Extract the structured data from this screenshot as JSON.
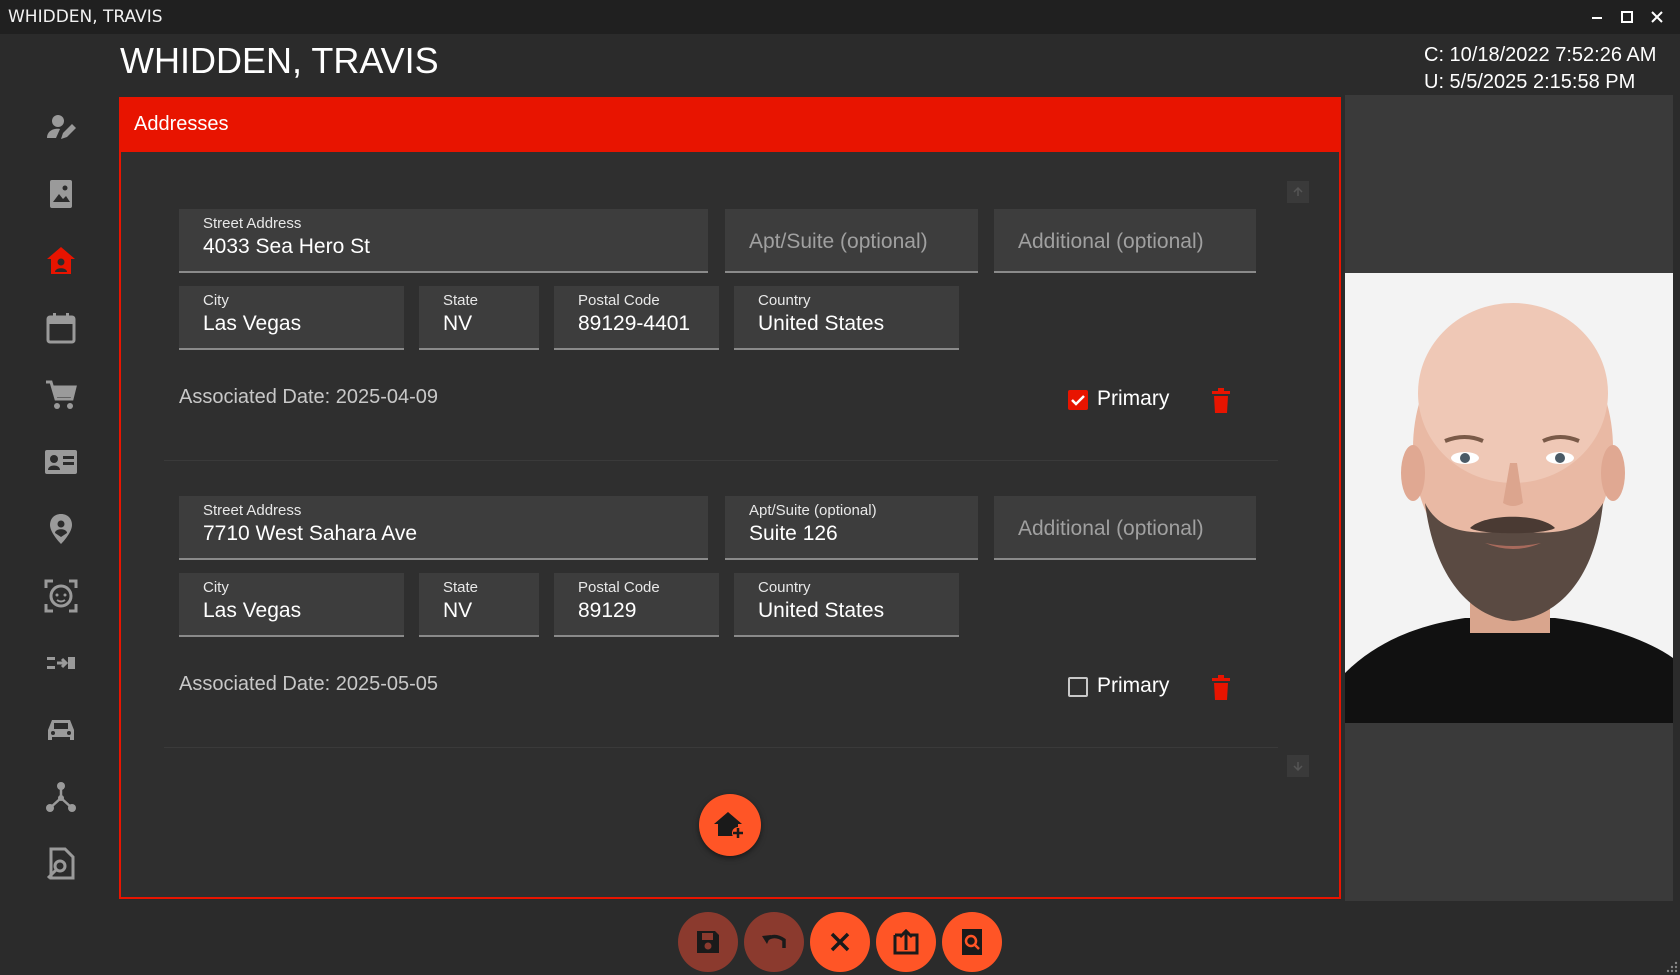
{
  "window": {
    "title": "WHIDDEN, TRAVIS",
    "minimize_icon": "minimize-icon",
    "maximize_icon": "maximize-icon",
    "close_icon": "close-icon"
  },
  "header": {
    "name": "WHIDDEN, TRAVIS",
    "created": "C: 10/18/2022 7:52:26 AM",
    "updated": "U: 5/5/2025 2:15:58 PM"
  },
  "sidebar": {
    "items": [
      {
        "icon": "person-edit-icon"
      },
      {
        "icon": "photo-book-icon"
      },
      {
        "icon": "home-person-icon",
        "active": true
      },
      {
        "icon": "calendar-icon"
      },
      {
        "icon": "cart-icon"
      },
      {
        "icon": "contact-card-icon"
      },
      {
        "icon": "location-pin-icon"
      },
      {
        "icon": "face-scan-icon"
      },
      {
        "icon": "transfer-icon"
      },
      {
        "icon": "car-icon"
      },
      {
        "icon": "hierarchy-icon"
      },
      {
        "icon": "document-search-icon"
      }
    ]
  },
  "section": {
    "title": "Addresses"
  },
  "addresses": [
    {
      "street_label": "Street Address",
      "street": "4033 Sea Hero St",
      "apt_placeholder": "Apt/Suite (optional)",
      "apt": "",
      "additional_placeholder": "Additional (optional)",
      "city_label": "City",
      "city": "Las Vegas",
      "state_label": "State",
      "state": "NV",
      "postal_label": "Postal Code",
      "postal": "89129-4401",
      "country_label": "Country",
      "country": "United States",
      "associated": "Associated Date: 2025-04-09",
      "primary_label": "Primary",
      "primary": true
    },
    {
      "street_label": "Street Address",
      "street": "7710 West Sahara Ave",
      "apt_label": "Apt/Suite (optional)",
      "apt": "Suite 126",
      "additional_placeholder": "Additional (optional)",
      "city_label": "City",
      "city": "Las Vegas",
      "state_label": "State",
      "state": "NV",
      "postal_label": "Postal Code",
      "postal": "89129",
      "country_label": "Country",
      "country": "United States",
      "associated": "Associated Date: 2025-05-05",
      "primary_label": "Primary",
      "primary": false
    }
  ],
  "actions": [
    {
      "icon": "save-icon",
      "enabled": false
    },
    {
      "icon": "undo-icon",
      "enabled": false
    },
    {
      "icon": "close-icon",
      "enabled": true
    },
    {
      "icon": "export-icon",
      "enabled": true
    },
    {
      "icon": "preview-search-icon",
      "enabled": true
    }
  ],
  "colors": {
    "accent": "#e81400",
    "fab": "#ff5526",
    "disabled_button": "#8b3a2e",
    "background": "#2b2b2b"
  }
}
